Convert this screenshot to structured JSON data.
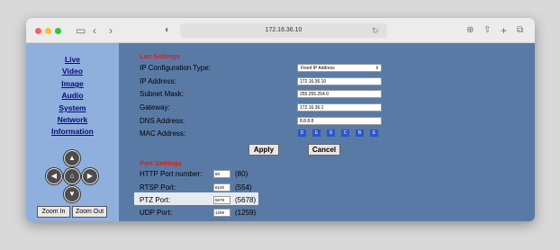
{
  "browser": {
    "url": "172.16.36.10"
  },
  "sidebar": {
    "links": [
      "Live",
      "Video",
      "Image",
      "Audio",
      "System",
      "Network",
      "Information"
    ],
    "zoom_in": "Zoom In",
    "zoom_out": "Zoom Out"
  },
  "lan": {
    "title": "Lan Settings",
    "ip_type_label": "IP Configuration Type:",
    "ip_type_value": "Fixed IP Address",
    "ip_label": "IP Address:",
    "ip_value": "172.16.36.10",
    "mask_label": "Subnet Mask:",
    "mask_value": "255.255.254.0",
    "gateway_label": "Gateway:",
    "gateway_value": "172.16.36.1",
    "dns_label": "DNS Address:",
    "dns_value": "8.8.8.8",
    "mac_label": "MAC Address:",
    "mac_value": [
      "D",
      "E",
      "8",
      "C",
      "B",
      "E"
    ],
    "apply": "Apply",
    "cancel": "Cancel"
  },
  "ports": {
    "title": "Port Settings",
    "http_label": "HTTP Port number:",
    "http_value": "80",
    "http_default": "(80)",
    "rtsp_label": "RTSP Port:",
    "rtsp_value": "8100",
    "rtsp_default": "(554)",
    "ptz_label": "PTZ Port:",
    "ptz_value": "5678",
    "ptz_default": "(5678)",
    "udp_label": "UDP Port:",
    "udp_value": "1259",
    "udp_default": "(1259)"
  },
  "colors": {
    "page_bg": "#5a7aa6",
    "sidebar_bg": "#8fb0dd",
    "section_title": "#d0241a",
    "nav_link": "#0a0a7a"
  },
  "icons": [
    "sidebar-toggle-icon",
    "back-icon",
    "forward-icon",
    "shield-icon",
    "refresh-icon",
    "download-icon",
    "share-icon",
    "new-tab-icon",
    "tabs-icon",
    "arrow-up-icon",
    "arrow-left-icon",
    "home-icon",
    "arrow-right-icon",
    "arrow-down-icon"
  ]
}
